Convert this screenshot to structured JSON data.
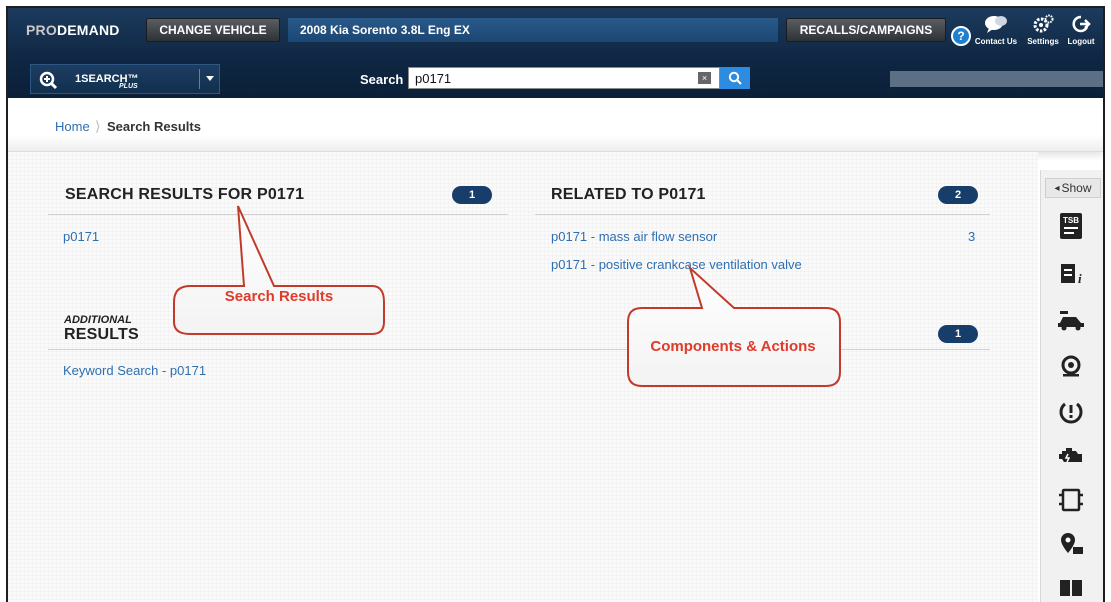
{
  "header": {
    "logo_pro": "PRO",
    "logo_demand": "DEMAND",
    "change_vehicle_label": "CHANGE VEHICLE",
    "vehicle": "2008 Kia Sorento 3.8L Eng EX",
    "recalls_label": "RECALLS/CAMPAIGNS",
    "help_label": "?",
    "contact_label": "Contact Us",
    "settings_label": "Settings",
    "logout_label": "Logout"
  },
  "searchbar": {
    "onesearch_label": "1SEARCH™",
    "onesearch_sub": "PLUS",
    "search_label": "Search",
    "query": "p0171",
    "clear_label": "×"
  },
  "breadcrumb": {
    "home": "Home",
    "separator": "⟩",
    "current": "Search Results"
  },
  "results": {
    "title": "SEARCH RESULTS FOR P0171",
    "count": "1",
    "items": [
      "p0171"
    ]
  },
  "related": {
    "title": "RELATED TO P0171",
    "count": "2",
    "items": [
      {
        "label": "p0171 - mass air flow sensor",
        "count": "3"
      },
      {
        "label": "p0171 - positive crankcase ventilation valve",
        "count": ""
      }
    ]
  },
  "additional": {
    "small": "ADDITIONAL",
    "title": "RESULTS",
    "count": "1",
    "items": [
      "Keyword Search - p0171"
    ]
  },
  "callouts": {
    "search_results": "Search Results",
    "components_actions": "Components & Actions"
  },
  "toolbar": {
    "show_label": "Show",
    "tools": [
      "tsb-icon",
      "document-info-icon",
      "vehicle-lift-icon",
      "tire-icon",
      "tpms-icon",
      "engine-icon",
      "wiring-icon",
      "location-icon",
      "manual-book-icon"
    ]
  },
  "colors": {
    "header_navy": "#0f2743",
    "vehicle_blue": "#1a4673",
    "badge_navy": "#173e6b",
    "link_blue": "#2d6fb0",
    "callout_red": "#e03a2a",
    "search_button_blue": "#2d8ce0"
  }
}
